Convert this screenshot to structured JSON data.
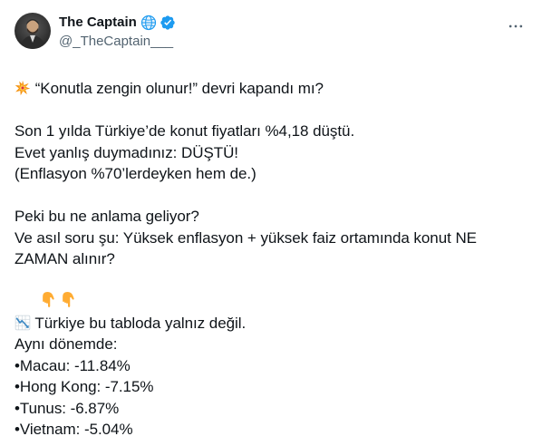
{
  "author": {
    "display_name": "The Captain",
    "handle": "@_TheCaptain___"
  },
  "icons": {
    "globe": "globe-icon",
    "verified": "verified-badge-icon",
    "more": "more-options-icon",
    "explosion": "collision-emoji",
    "pointing": "pointing-down-emoji",
    "chart": "chart-decreasing-emoji"
  },
  "colors": {
    "verified": "#1d9bf0",
    "text": "#0f1419",
    "secondary": "#536471"
  },
  "tweet": {
    "line_1": "“Konutla zengin olunur!” devri kapandı mı?",
    "line_2": "Son 1 yılda Türkiye’de konut fiyatları %4,18 düştü.",
    "line_3": "Evet yanlış duymadınız: DÜŞTÜ!",
    "line_4": "(Enflasyon %70’lerdeyken hem de.)",
    "line_5": "Peki bu ne anlama geliyor?",
    "line_6": "Ve asıl soru şu: Yüksek enflasyon + yüksek faiz ortamında konut NE",
    "line_7": "ZAMAN alınır?",
    "line_8": "Türkiye bu tabloda yalnız değil.",
    "line_9": "Aynı dönemde:",
    "line_10": "•Macau: -11.84%",
    "line_11": "•Hong Kong: -7.15%",
    "line_12": "•Tunus: -6.87%",
    "line_13": "•Vietnam: -5.04%"
  }
}
